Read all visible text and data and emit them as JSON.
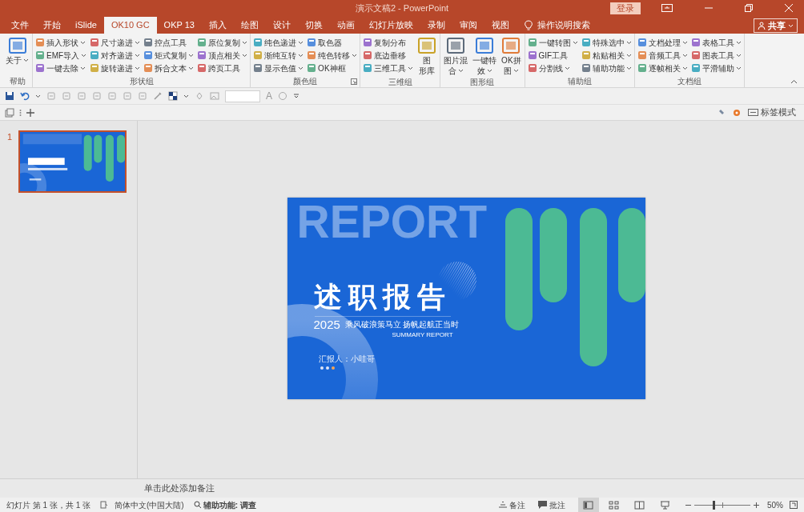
{
  "window": {
    "title": "演示文稿2 - PowerPoint",
    "login": "登录"
  },
  "tabs": [
    {
      "label": "文件",
      "selected": false
    },
    {
      "label": "开始",
      "selected": false
    },
    {
      "label": "iSlide",
      "selected": false
    },
    {
      "label": "OK10 GC",
      "selected": true
    },
    {
      "label": "OKP 13",
      "selected": false
    },
    {
      "label": "插入",
      "selected": false
    },
    {
      "label": "绘图",
      "selected": false
    },
    {
      "label": "设计",
      "selected": false
    },
    {
      "label": "切换",
      "selected": false
    },
    {
      "label": "动画",
      "selected": false
    },
    {
      "label": "幻灯片放映",
      "selected": false
    },
    {
      "label": "录制",
      "selected": false
    },
    {
      "label": "审阅",
      "selected": false
    },
    {
      "label": "视图",
      "selected": false
    }
  ],
  "tell_me": "操作说明搜索",
  "share": "共享",
  "ribbon_groups": [
    {
      "label": "帮助",
      "launcher": false,
      "columns": [
        {
          "kind": "large",
          "lines": [
            "关于"
          ],
          "dropdown": true
        }
      ]
    },
    {
      "label": "形状组",
      "launcher": false,
      "columns": [
        {
          "kind": "stack",
          "items": [
            {
              "label": "插入形状",
              "dropdown": true
            },
            {
              "label": "EMF导入",
              "dropdown": true
            },
            {
              "label": "一键去除",
              "dropdown": true
            }
          ]
        },
        {
          "kind": "stack",
          "items": [
            {
              "label": "尺寸递进",
              "dropdown": true
            },
            {
              "label": "对齐递进",
              "dropdown": true
            },
            {
              "label": "旋转递进",
              "dropdown": true
            }
          ]
        },
        {
          "kind": "stack",
          "items": [
            {
              "label": "控点工具",
              "dropdown": false
            },
            {
              "label": "矩式复制",
              "dropdown": true
            },
            {
              "label": "拆合文本",
              "dropdown": true
            }
          ]
        },
        {
          "kind": "stack",
          "items": [
            {
              "label": "原位复制",
              "dropdown": true
            },
            {
              "label": "顶点相关",
              "dropdown": true
            },
            {
              "label": "跨页工具",
              "dropdown": false
            }
          ]
        }
      ]
    },
    {
      "label": "颜色组",
      "launcher": true,
      "columns": [
        {
          "kind": "stack",
          "items": [
            {
              "label": "纯色递进",
              "dropdown": true
            },
            {
              "label": "渐纯互转",
              "dropdown": true
            },
            {
              "label": "显示色值",
              "dropdown": true
            }
          ]
        },
        {
          "kind": "stack",
          "items": [
            {
              "label": "取色器",
              "dropdown": false
            },
            {
              "label": "纯色转移",
              "dropdown": true
            },
            {
              "label": "OK神框",
              "dropdown": false
            }
          ]
        }
      ]
    },
    {
      "label": "三维组",
      "launcher": false,
      "columns": [
        {
          "kind": "stack",
          "items": [
            {
              "label": "复制分布",
              "dropdown": false
            },
            {
              "label": "底边垂移",
              "dropdown": false
            },
            {
              "label": "三维工具",
              "dropdown": true
            }
          ]
        },
        {
          "kind": "large",
          "lines": [
            "图",
            "形库"
          ],
          "dropdown": false
        }
      ]
    },
    {
      "label": "图形组",
      "launcher": false,
      "columns": [
        {
          "kind": "large",
          "lines": [
            "图片混",
            "合"
          ],
          "dropdown": true
        },
        {
          "kind": "large",
          "lines": [
            "一键特",
            "效"
          ],
          "dropdown": true
        },
        {
          "kind": "large",
          "lines": [
            "OK拼",
            "图"
          ],
          "dropdown": true
        }
      ]
    },
    {
      "label": "辅助组",
      "launcher": false,
      "columns": [
        {
          "kind": "stack",
          "items": [
            {
              "label": "一键转图",
              "dropdown": true
            },
            {
              "label": "GIF工具",
              "dropdown": false
            },
            {
              "label": "分割线",
              "dropdown": true
            }
          ]
        },
        {
          "kind": "stack",
          "items": [
            {
              "label": "特殊选中",
              "dropdown": true
            },
            {
              "label": "粘贴相关",
              "dropdown": true
            },
            {
              "label": "辅助功能",
              "dropdown": true
            }
          ]
        }
      ]
    },
    {
      "label": "文档组",
      "launcher": false,
      "columns": [
        {
          "kind": "stack",
          "items": [
            {
              "label": "文档处理",
              "dropdown": true
            },
            {
              "label": "音频工具",
              "dropdown": true
            },
            {
              "label": "逐帧相关",
              "dropdown": true
            }
          ]
        },
        {
          "kind": "stack",
          "items": [
            {
              "label": "表格工具",
              "dropdown": true
            },
            {
              "label": "图表工具",
              "dropdown": true
            },
            {
              "label": "平滑辅助",
              "dropdown": true
            }
          ]
        }
      ]
    }
  ],
  "quick_access": {
    "font_button": "A"
  },
  "toolbar2": {
    "mode_label": "标签模式"
  },
  "slides": [
    {
      "number": "1",
      "selected": true
    }
  ],
  "slide": {
    "watermark": "REPORT",
    "title": "述职报告",
    "year": "2025",
    "subtitle": "乘风破浪策马立 扬帆起航正当时",
    "english": "SUMMARY REPORT",
    "presenter": "汇报人：小哇哥",
    "dots": [
      {
        "color": "#dce4f5"
      },
      {
        "color": "#dce4f5"
      },
      {
        "color": "#f2a557"
      }
    ]
  },
  "notes_pane": {
    "prompt": "单击此处添加备注"
  },
  "status_bar": {
    "slide_info": "幻灯片 第 1 张，共 1 张",
    "language": "简体中文(中国大陆)",
    "accessibility": "辅助功能: 调查",
    "notes": "备注",
    "comments": "批注",
    "views": [
      {
        "kind": "normal",
        "selected": true
      },
      {
        "kind": "sorter",
        "selected": false
      },
      {
        "kind": "reading",
        "selected": false
      },
      {
        "kind": "slideshow",
        "selected": false
      }
    ],
    "zoom": {
      "level": 0.35,
      "reading": "50%"
    }
  }
}
